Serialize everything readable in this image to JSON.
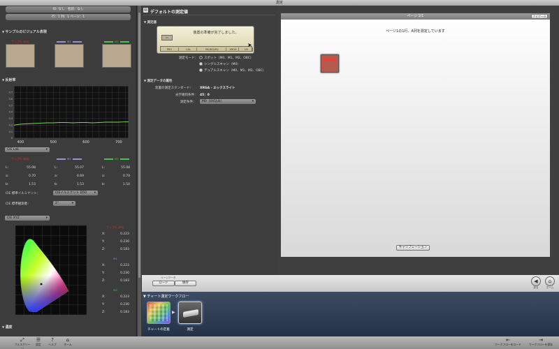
{
  "window": {
    "title": "測定"
  },
  "left": {
    "top_pill_1": "ID: なし　名前：なし",
    "top_pill_2": "行：1  列：1  ページ：1",
    "visual_section": "サンプルのビジュアル表現",
    "patch_labels": [
      "サンプル (M0)",
      "M1",
      "M2"
    ],
    "patch_color": "#b8a88f",
    "spectral_section": "反射率",
    "spectral": {
      "type": "line",
      "x": [
        380,
        400,
        420,
        440,
        460,
        480,
        500,
        520,
        540,
        560,
        580,
        600,
        620,
        640,
        660,
        680,
        700,
        720,
        730
      ],
      "y": [
        0.2,
        0.215,
        0.22,
        0.225,
        0.23,
        0.235,
        0.235,
        0.24,
        0.24,
        0.235,
        0.24,
        0.24,
        0.235,
        0.24,
        0.245,
        0.245,
        0.245,
        0.25,
        0.25
      ],
      "x_ticks": [
        "400",
        "500",
        "600",
        "700"
      ],
      "y_ticks": [
        "0",
        "0.1",
        "0.2",
        "0.3",
        "0.4",
        "0.5",
        "0.6",
        "0.7"
      ],
      "xlim": [
        380,
        730
      ],
      "ylim": [
        0,
        0.8
      ],
      "grid": true,
      "line_color": "#6de34a"
    },
    "lab_dropdown": "CIE Lab",
    "lab_col_labels": [
      "サンプル (M0)",
      "M1",
      "M2"
    ],
    "lab_rows": [
      {
        "label": "L:",
        "m0": "55.08",
        "m1": "55.07",
        "m2": "55.08"
      },
      {
        "label": "a:",
        "m0": "0.70",
        "m1": "0.69",
        "m2": "0.70"
      },
      {
        "label": "b:",
        "m0": "1.53",
        "m1": "1.53",
        "m2": "1.54"
      }
    ],
    "illuminant_label": "CIE 標準イルミナント：",
    "illuminant_value": "CIEイルミナント D50",
    "observer_label": "CIE 標準観測者：",
    "observer_value": "2°",
    "xyz_dropdown": "CIE XYZ",
    "xyz_groups": [
      {
        "name": "サンプル (M0)",
        "color": "#e23030",
        "rows": [
          [
            "X:",
            "0.223"
          ],
          [
            "Y:",
            "0.230"
          ],
          [
            "Z:",
            "0.183"
          ]
        ]
      },
      {
        "name": "M1",
        "color": "#a58ad8",
        "rows": [
          [
            "X:",
            "0.223"
          ],
          [
            "Y:",
            "0.230"
          ],
          [
            "Z:",
            "0.183"
          ]
        ]
      },
      {
        "name": "M2",
        "color": "#46c846",
        "rows": [
          [
            "X:",
            "0.223"
          ],
          [
            "Y:",
            "0.230"
          ],
          [
            "Z:",
            "0.183"
          ]
        ]
      }
    ],
    "density_section": "濃度"
  },
  "center": {
    "header": "デフォルトの測定値",
    "device_section": "測定器",
    "meter_message": "装置の準備が完了しました。",
    "meter_buttons": [
      "PRO",
      "CAL",
      "M0/M1/M2",
      "XRGA",
      "UV"
    ],
    "mode_label": "測定モード：",
    "modes": [
      "スポット（M0、M1、M2、OBC）",
      "シングルスキャン（M0）",
      "デュアルスキャン（M0、M1、M2、OBC）"
    ],
    "attr_section": "測定データの属性",
    "std_label": "装置の測定スタンダード：",
    "std_value": "XRGA - エックスライト",
    "geom_label": "光学幾何条件：",
    "geom_value": "45：0",
    "cond_label": "測定条件：",
    "cond_value": "M0（UV込み）"
  },
  "right": {
    "page_header": "ページ 1/1",
    "nav_button": "ナビゲータ",
    "instruction": "ページ1の1行、A列を測定しています",
    "patch_color": "#b45a4f",
    "calibrate_button": "キャリブレーション"
  },
  "bottom": {
    "page_data_label": "ページデータ",
    "load_button": "ロード",
    "save_button": "保存",
    "back_label": "戻る",
    "home_label": "ホーム"
  },
  "workflow": {
    "title": "チャート測定ワークフロー",
    "steps": [
      "チャートの定義",
      "測定"
    ]
  },
  "dock": {
    "left_items": [
      "フルスクリーン",
      "設定",
      "ヘルプ",
      "ホーム"
    ],
    "right_items": [
      "ワークフローをロード",
      "ワークフローを保存"
    ]
  }
}
